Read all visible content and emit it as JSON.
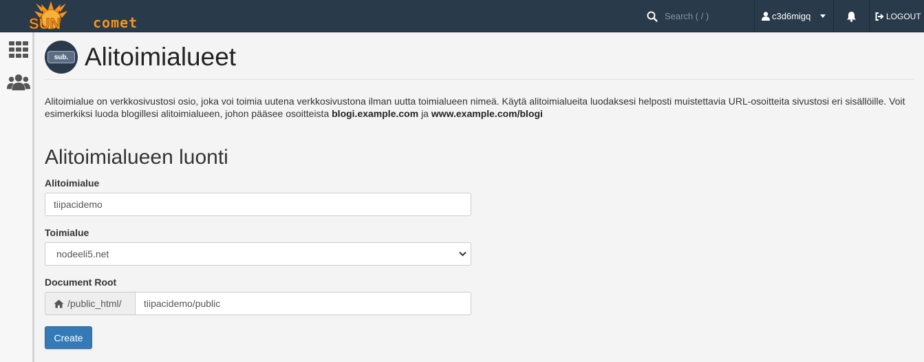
{
  "brand": {
    "sun": "SUN",
    "comet": "comet",
    "color": "#f7931e"
  },
  "topbar": {
    "search_placeholder": "Search ( / )",
    "username": "c3d6migq",
    "logout_label": "LOGOUT",
    "icons": [
      "search-icon",
      "user-icon",
      "caret-down-icon",
      "bell-icon",
      "logout-icon"
    ]
  },
  "sidebar": {
    "items": [
      {
        "icon": "grid-icon"
      },
      {
        "icon": "users-icon"
      }
    ]
  },
  "page": {
    "icon_text": "sub.",
    "title": "Alitoimialueet",
    "description_text": "Alitoimialue on verkkosivustosi osio, joka voi toimia uutena verkkosivustona ilman uutta toimialueen nimeä. Käytä alitoimialueita luodaksesi helposti muistettavia URL-osoitteita sivustosi eri sisällöille. Voit esimerkiksi luoda blogillesi alitoimialueen, johon pääsee osoitteista",
    "example_url_1": "blogi.example.com",
    "joiner": "ja",
    "example_url_2": "www.example.com/blogi"
  },
  "form": {
    "section_title": "Alitoimialueen luonti",
    "subdomain_label": "Alitoimialue",
    "subdomain_value": "tiipacidemo",
    "domain_label": "Toimialue",
    "domain_value": "nodeeli5.net",
    "docroot_label": "Document Root",
    "docroot_prefix": "/public_html/",
    "docroot_value": "tiipacidemo/public",
    "create_label": "Create",
    "button_color": "#337ab7"
  }
}
